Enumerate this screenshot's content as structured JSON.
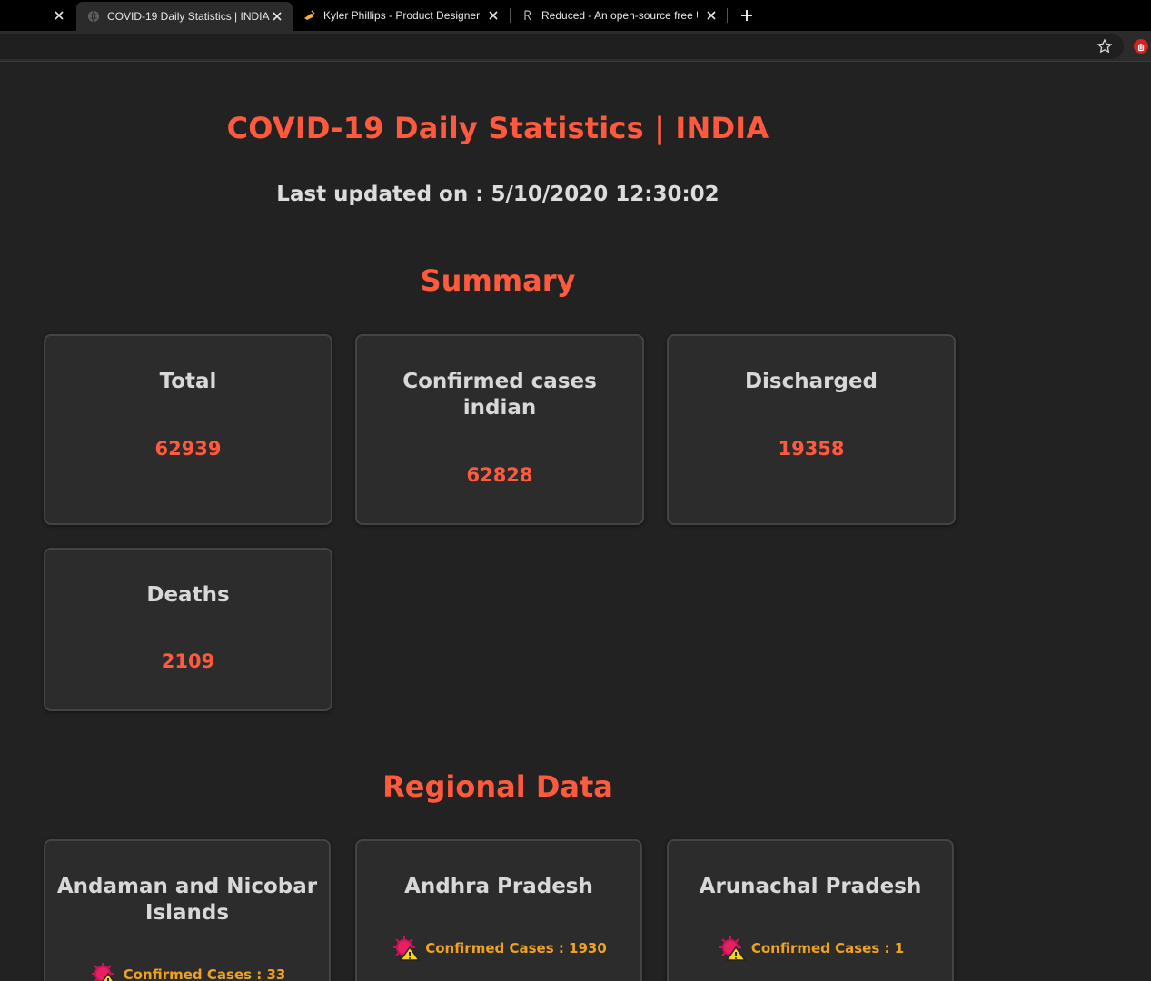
{
  "browser": {
    "tabs": [
      {
        "title": "",
        "active": false
      },
      {
        "title": "COVID-19 Daily Statistics | INDIA",
        "active": true
      },
      {
        "title": "Kyler Phillips - Product Designer",
        "active": false
      },
      {
        "title": "Reduced - An open-source free U",
        "active": false
      }
    ],
    "icons": {
      "close": "close-icon",
      "new_tab": "plus-icon",
      "bookmark": "star-icon",
      "extension": "stop-hand-icon"
    }
  },
  "header": {
    "title": "COVID-19 Daily Statistics | INDIA",
    "updated_label": "Last updated on : 5/10/2020 12:30:02"
  },
  "summary": {
    "heading": "Summary",
    "cards": [
      {
        "label": "Total",
        "value": "62939"
      },
      {
        "label": "Confirmed cases indian",
        "value": "62828"
      },
      {
        "label": "Discharged",
        "value": "19358"
      },
      {
        "label": "Deaths",
        "value": "2109"
      }
    ]
  },
  "regional": {
    "heading": "Regional Data",
    "regions": [
      {
        "name": "Andaman and Nicobar Islands",
        "confirmed": "Confirmed Cases : 33"
      },
      {
        "name": "Andhra Pradesh",
        "confirmed": "Confirmed Cases : 1930"
      },
      {
        "name": "Arunachal Pradesh",
        "confirmed": "Confirmed Cases : 1"
      }
    ]
  },
  "colors": {
    "background": "#222222",
    "accent": "#ff5a3d",
    "card": "#2c2c2c",
    "confirmed": "#f0a21e",
    "text": "#d8d8d8"
  }
}
